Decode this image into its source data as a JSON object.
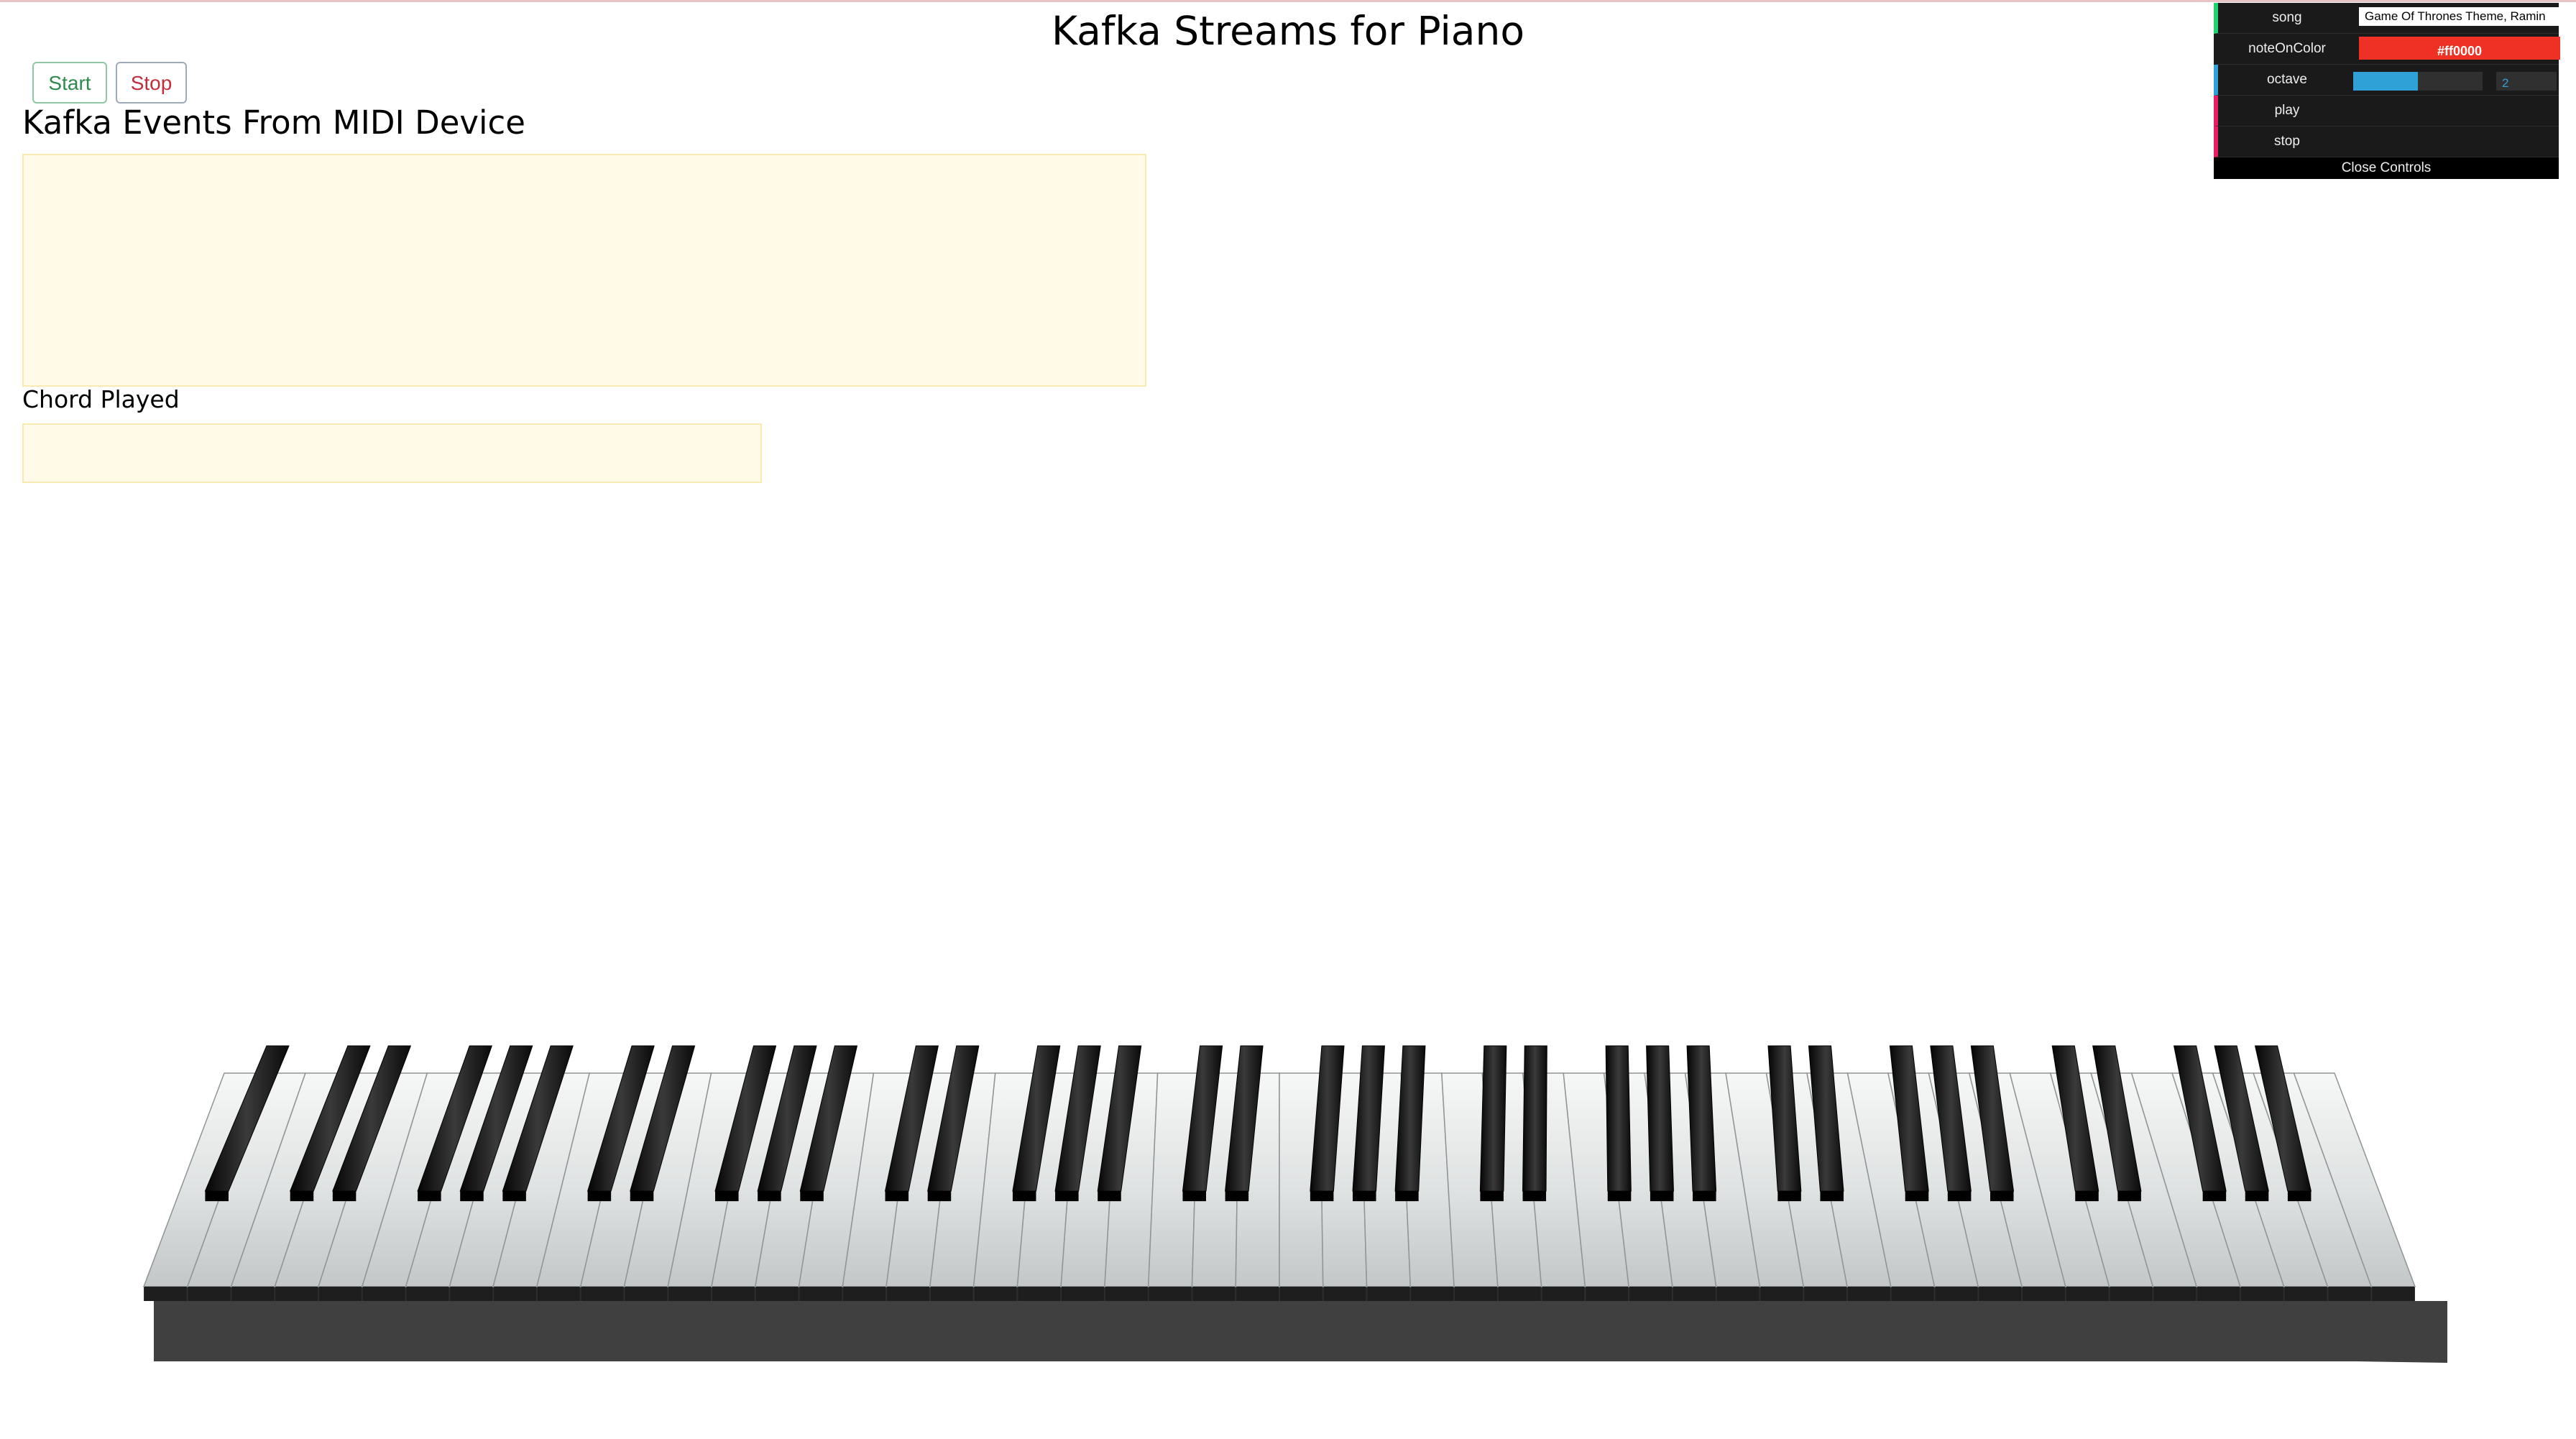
{
  "header": {
    "title": "Kafka Streams for Piano"
  },
  "controls": {
    "start_label": "Start",
    "stop_label": "Stop"
  },
  "events": {
    "heading": "Kafka Events From MIDI Device",
    "content": ""
  },
  "chord": {
    "label": "Chord Played",
    "value": ""
  },
  "gui": {
    "song_label": "song",
    "song_value": "Game Of Thrones Theme, Ramin",
    "note_color_label": "noteOnColor",
    "note_color_value": "#ff0000",
    "octave_label": "octave",
    "octave_value": "2",
    "octave_fill_fraction": 0.5,
    "play_label": "play",
    "stop_label": "stop",
    "close_label": "Close Controls"
  },
  "colors": {
    "start_text": "#2f8a4e",
    "stop_text": "#c22d3a",
    "log_box_bg": "#fffbe8",
    "note_on": "#ee3124",
    "gui_accent": "#2fa1d6"
  },
  "piano": {
    "white_keys": 52,
    "black_keys": 36
  }
}
